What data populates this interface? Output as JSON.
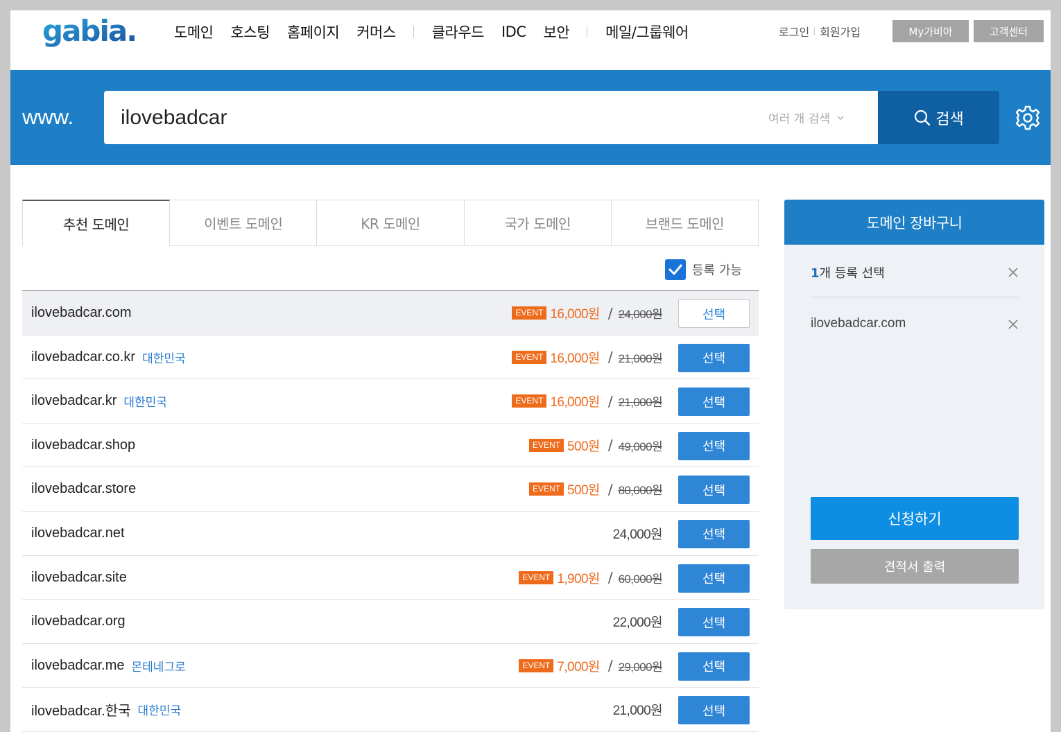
{
  "header": {
    "logo_text": "gabia.",
    "nav": [
      "도메인",
      "호스팅",
      "홈페이지",
      "커머스",
      "클라우드",
      "IDC",
      "보안",
      "메일/그룹웨어"
    ],
    "login": "로그인",
    "signup": "회원가입",
    "my_gabia": "My가비아",
    "support": "고객센터"
  },
  "search": {
    "prefix": "www.",
    "value": "ilovebadcar",
    "multi_label": "여러 개 검색",
    "button_label": "검색"
  },
  "tabs": [
    "추천 도메인",
    "이벤트 도메인",
    "KR 도메인",
    "국가 도메인",
    "브랜드 도메인"
  ],
  "filter": {
    "label": "등록 가능",
    "checked": true
  },
  "results": [
    {
      "domain": "ilovebadcar.com",
      "country": "",
      "event": "EVENT",
      "price": "16,000원",
      "original": "24,000원",
      "button": "선택",
      "selected": true
    },
    {
      "domain": "ilovebadcar.co.kr",
      "country": "대한민국",
      "event": "EVENT",
      "price": "16,000원",
      "original": "21,000원",
      "button": "선택",
      "selected": false
    },
    {
      "domain": "ilovebadcar.kr",
      "country": "대한민국",
      "event": "EVENT",
      "price": "16,000원",
      "original": "21,000원",
      "button": "선택",
      "selected": false
    },
    {
      "domain": "ilovebadcar.shop",
      "country": "",
      "event": "EVENT",
      "price": "500원",
      "original": "49,000원",
      "button": "선택",
      "selected": false
    },
    {
      "domain": "ilovebadcar.store",
      "country": "",
      "event": "EVENT",
      "price": "500원",
      "original": "80,000원",
      "button": "선택",
      "selected": false
    },
    {
      "domain": "ilovebadcar.net",
      "country": "",
      "event": "",
      "price": "24,000원",
      "original": "",
      "button": "선택",
      "selected": false
    },
    {
      "domain": "ilovebadcar.site",
      "country": "",
      "event": "EVENT",
      "price": "1,900원",
      "original": "60,000원",
      "button": "선택",
      "selected": false
    },
    {
      "domain": "ilovebadcar.org",
      "country": "",
      "event": "",
      "price": "22,000원",
      "original": "",
      "button": "선택",
      "selected": false
    },
    {
      "domain": "ilovebadcar.me",
      "country": "몬테네그로",
      "event": "EVENT",
      "price": "7,000원",
      "original": "29,000원",
      "button": "선택",
      "selected": false
    },
    {
      "domain": "ilovebadcar.한국",
      "country": "대한민국",
      "event": "",
      "price": "21,000원",
      "original": "",
      "button": "선택",
      "selected": false
    }
  ],
  "cart": {
    "title": "도메인 장바구니",
    "count": "1",
    "summary_suffix": "개 등록 선택",
    "items": [
      "ilovebadcar.com"
    ],
    "apply": "신청하기",
    "quote": "견적서 출력"
  },
  "colors": {
    "brand_blue": "#1f7fc6",
    "search_button": "#0f5fa3",
    "select_button": "#2f86d7",
    "event_orange": "#ef6b1c",
    "apply_button": "#0d8ee2"
  }
}
